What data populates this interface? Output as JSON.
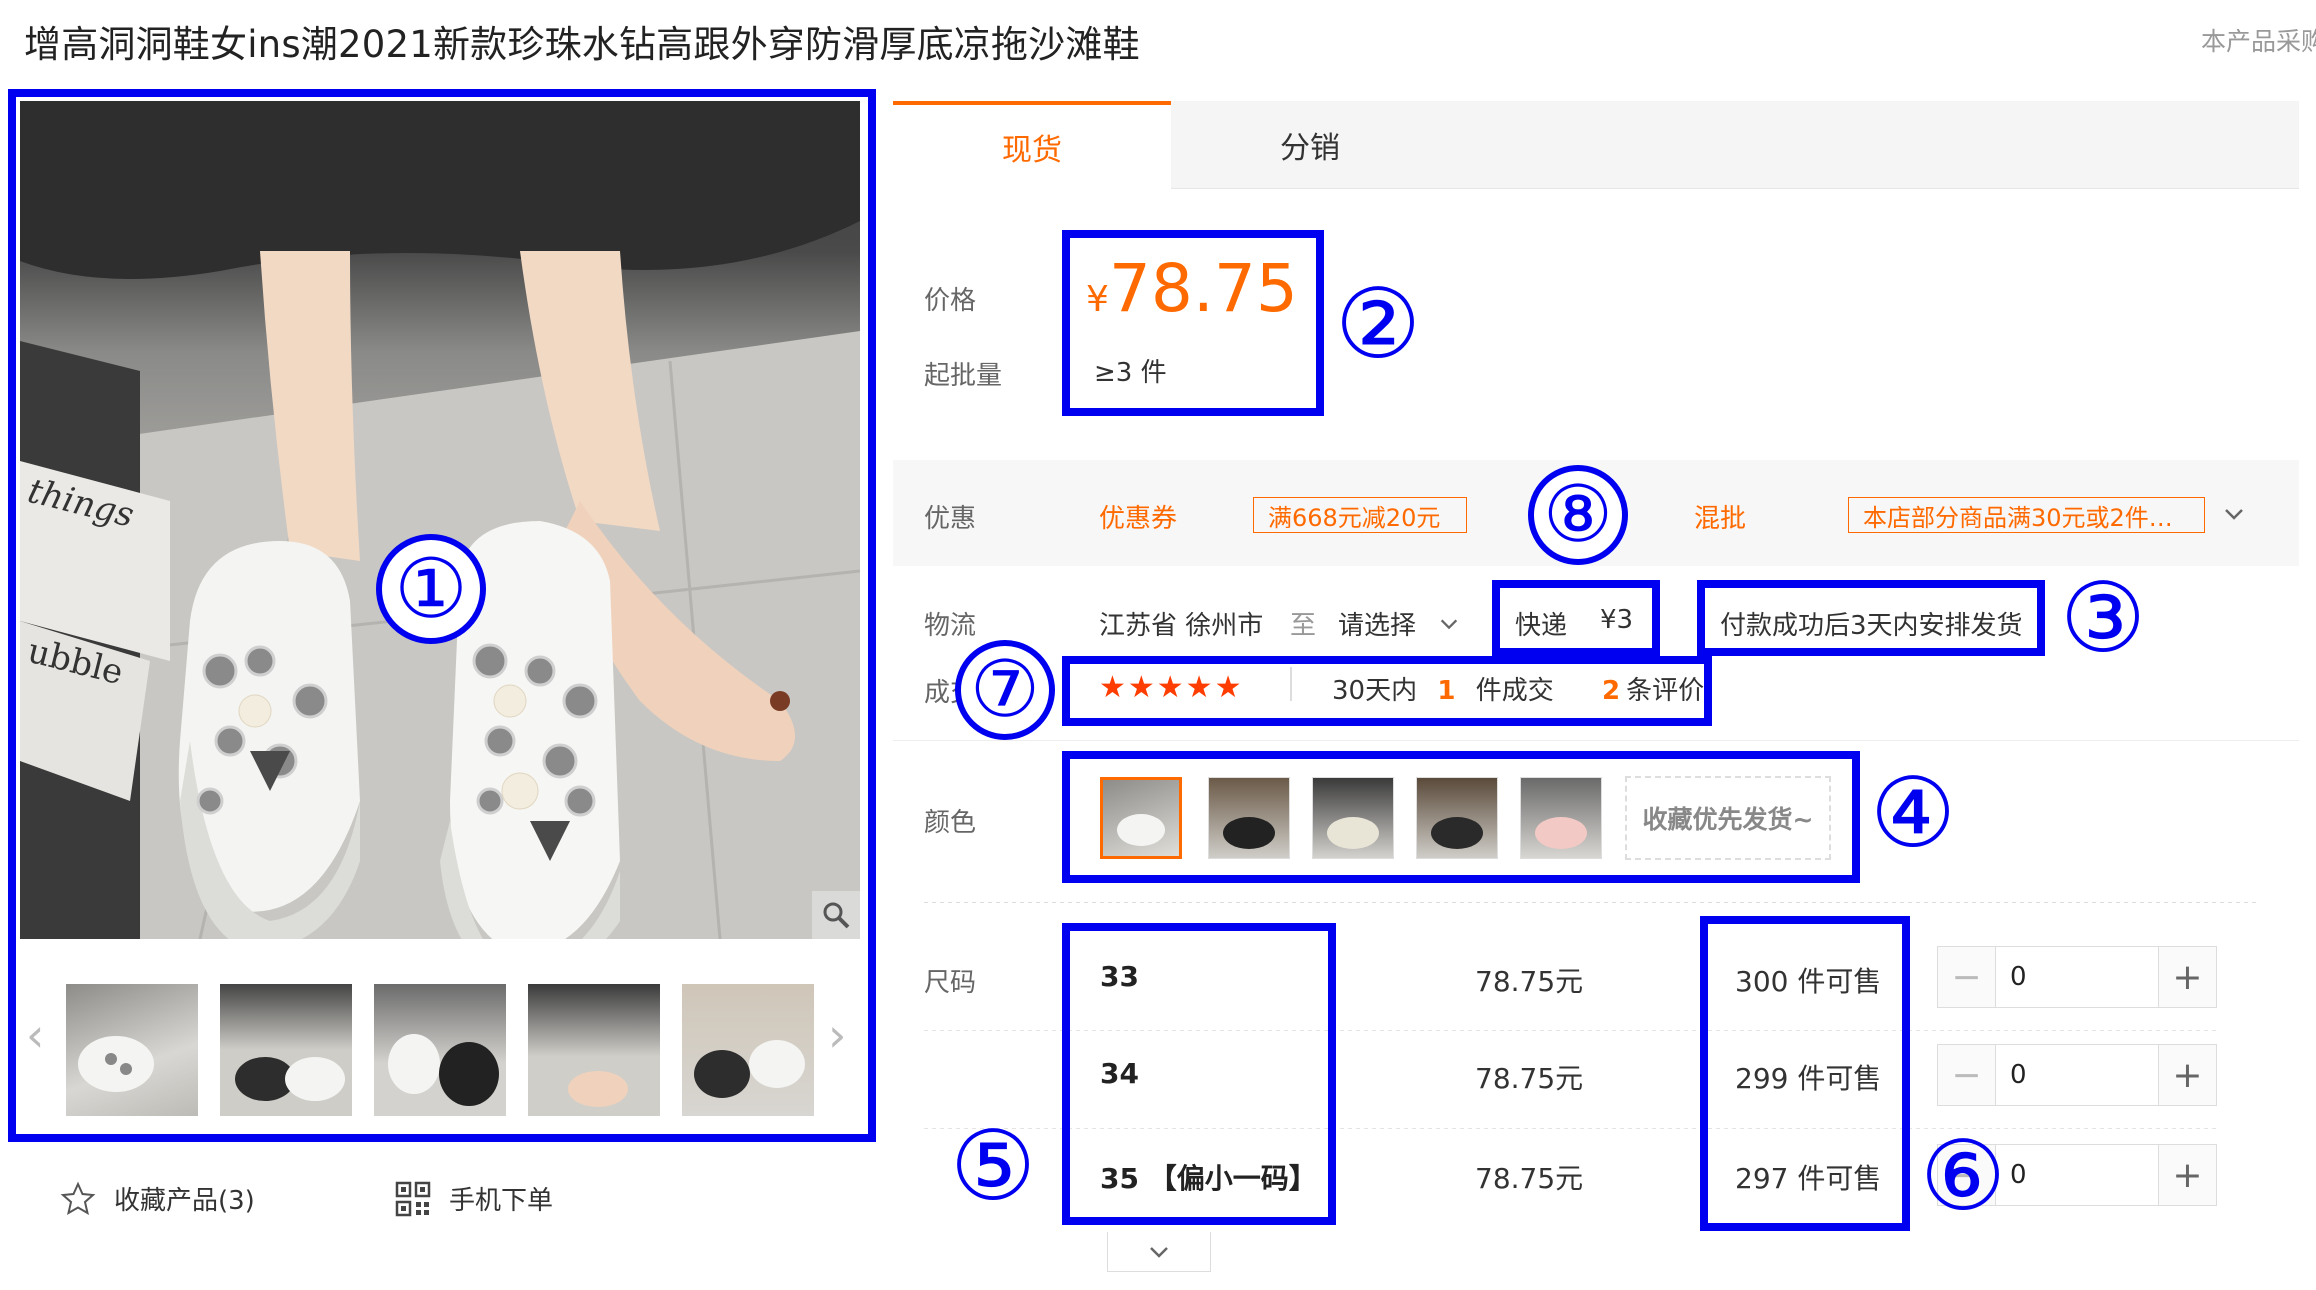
{
  "title": "增高洞洞鞋女ins潮2021新款珍珠水钻高跟外穿防滑厚底凉拖沙滩鞋",
  "purchase_note": "本产品采购",
  "gallery": {
    "prev": "‹",
    "next": "›",
    "zoom_icon": "search-icon",
    "print_text_1": "things",
    "print_text_2": "ubble"
  },
  "actions": {
    "favorite": "收藏产品(3)",
    "mobile_order": "手机下单"
  },
  "tabs": [
    "现货",
    "分销"
  ],
  "price": {
    "label": "价格",
    "currency": "¥",
    "value": "78.75",
    "min_label": "起批量",
    "min_value": "≥3 件"
  },
  "promo": {
    "label": "优惠",
    "coupon_label": "优惠券",
    "coupon_tag": "满668元减20元",
    "mix_label": "混批",
    "mix_tag": "本店部分商品满30元或2件…"
  },
  "logistics": {
    "label": "物流",
    "origin": "江苏省 徐州市",
    "to": "至",
    "destination": "请选择",
    "express_label": "快递",
    "express_fee": "¥3",
    "dispatch": "付款成功后3天内安排发货"
  },
  "deals": {
    "label": "成交",
    "stars": "★★★★★",
    "period": "30天内",
    "deal_count": "1",
    "deal_suffix": "件成交",
    "review_count": "2",
    "review_suffix": "条评价"
  },
  "color": {
    "label": "颜色",
    "collect_button": "收藏优先发货~"
  },
  "sizes": {
    "label": "尺码",
    "rows": [
      {
        "size": "33",
        "price": "78.75元",
        "stock": "300 件可售",
        "qty": "0"
      },
      {
        "size": "34",
        "price": "78.75元",
        "stock": "299 件可售",
        "qty": "0"
      },
      {
        "size": "35 【偏小一码】",
        "price": "78.75元",
        "stock": "297 件可售",
        "qty": "0"
      }
    ]
  },
  "annotations": [
    "①",
    "②",
    "③",
    "④",
    "⑤",
    "⑥",
    "⑦",
    "⑧"
  ],
  "colors": {
    "accent": "#ff6a00",
    "annotation": "#0000f0"
  }
}
